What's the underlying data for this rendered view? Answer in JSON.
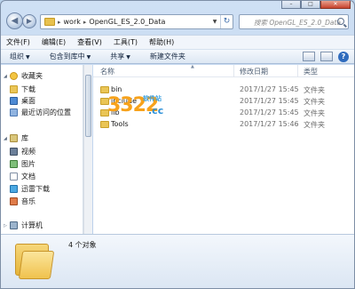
{
  "window": {
    "caption_buttons": [
      "–",
      "□",
      "✕"
    ]
  },
  "address": {
    "crumbs": [
      "work",
      "OpenGL_ES_2.0_Data"
    ],
    "search_placeholder": "搜索 OpenGL_ES_2.0_Data"
  },
  "menubar": {
    "items": [
      "文件(F)",
      "编辑(E)",
      "查看(V)",
      "工具(T)",
      "帮助(H)"
    ]
  },
  "commandbar": {
    "organize": "组织",
    "include_library": "包含到库中",
    "share": "共享",
    "new_folder": "新建文件夹"
  },
  "navpane": {
    "favorites": "收藏夹",
    "favorites_items": [
      "下载",
      "桌面",
      "最近访问的位置"
    ],
    "libraries": "库",
    "library_items": [
      "视频",
      "图片",
      "文档",
      "迅雷下载",
      "音乐"
    ],
    "computer": "计算机"
  },
  "filelist": {
    "columns": {
      "name": "名称",
      "date": "修改日期",
      "type": "类型"
    },
    "rows": [
      {
        "name": "bin",
        "date": "2017/1/27 15:45",
        "type": "文件夹"
      },
      {
        "name": "include",
        "date": "2017/1/27 15:45",
        "type": "文件夹"
      },
      {
        "name": "lib",
        "date": "2017/1/27 15:45",
        "type": "文件夹"
      },
      {
        "name": "Tools",
        "date": "2017/1/27 15:46",
        "type": "文件夹"
      }
    ]
  },
  "watermark": {
    "number": "3322",
    "brand": "软件站",
    "domain": ".cc"
  },
  "details": {
    "item_count": "4 个对象"
  }
}
